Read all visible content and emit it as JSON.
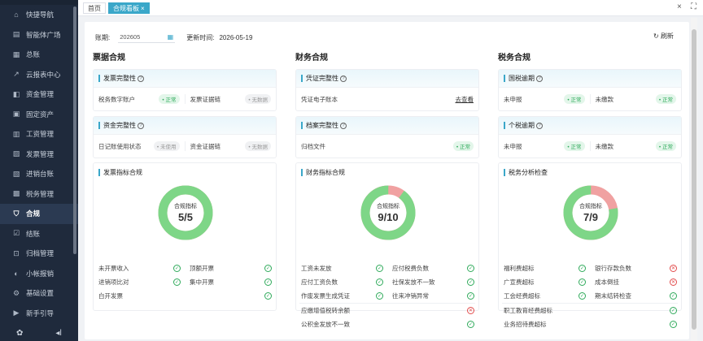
{
  "sidebar": {
    "items": [
      {
        "label": "快捷导航",
        "icon": "home-icon"
      },
      {
        "label": "智能体广场",
        "icon": "agent-icon"
      },
      {
        "label": "总账",
        "icon": "ledger-icon"
      },
      {
        "label": "云报表中心",
        "icon": "chart-icon"
      },
      {
        "label": "资金管理",
        "icon": "money-icon"
      },
      {
        "label": "固定资产",
        "icon": "asset-icon"
      },
      {
        "label": "工资管理",
        "icon": "salary-icon"
      },
      {
        "label": "发票管理",
        "icon": "invoice-icon"
      },
      {
        "label": "进销台账",
        "icon": "inventory-icon"
      },
      {
        "label": "税务管理",
        "icon": "tax-icon"
      },
      {
        "label": "合规",
        "icon": "shield-icon",
        "active": true
      },
      {
        "label": "结账",
        "icon": "close-book-icon"
      },
      {
        "label": "归档管理",
        "icon": "archive-icon"
      },
      {
        "label": "小帐报销",
        "icon": "reimburse-icon"
      },
      {
        "label": "基础设置",
        "icon": "settings-icon"
      },
      {
        "label": "新手引导",
        "icon": "guide-icon"
      }
    ]
  },
  "tabs": [
    {
      "label": "首页"
    },
    {
      "label": "合规看板",
      "active": true
    }
  ],
  "filter": {
    "period_label": "账期:",
    "period_value": "202605",
    "update_label": "更新时间:",
    "update_value": "2026-05-19",
    "refresh_label": "刷新"
  },
  "columns": {
    "c1": {
      "title": "票据合规",
      "card1": {
        "title": "发票完整性",
        "left_label": "税务数字账户",
        "left_badge": "• 正常",
        "right_label": "发票证据链",
        "right_badge": "• 无数据"
      },
      "card2": {
        "title": "资金完整性",
        "left_label": "日记账使用状态",
        "left_badge": "• 未使用",
        "right_label": "资金证据链",
        "right_badge": "• 无数据"
      },
      "donut": {
        "title": "发票指标合规",
        "center_label": "合规指标",
        "value": "5/5",
        "ok": 5,
        "total": 5
      },
      "indicators": [
        {
          "label": "未开票收入",
          "ok": true
        },
        {
          "label": "顶额开票",
          "ok": true
        },
        {
          "label": "进销项比对",
          "ok": true
        },
        {
          "label": "集中开票",
          "ok": true
        },
        {
          "label": "白开发票",
          "ok": true
        }
      ]
    },
    "c2": {
      "title": "财务合规",
      "card1": {
        "title": "凭证完整性",
        "label": "凭证电子账本",
        "link": "去查看"
      },
      "card2": {
        "title": "档案完整性",
        "label": "归档文件",
        "badge": "• 正常"
      },
      "donut": {
        "title": "财务指标合规",
        "center_label": "合规指标",
        "value": "9/10",
        "ok": 9,
        "total": 10
      },
      "indicators": [
        {
          "label": "工资未发放",
          "ok": true
        },
        {
          "label": "应付税费负数",
          "ok": true
        },
        {
          "label": "应付工资负数",
          "ok": true
        },
        {
          "label": "社保发放不一致",
          "ok": true
        },
        {
          "label": "作废发票生成凭证",
          "ok": true
        },
        {
          "label": "往来冲销异常",
          "ok": true
        },
        {
          "label": "应缴增值税转余额",
          "ok": false,
          "full": true
        },
        {
          "label": "公积金发放不一致",
          "ok": true,
          "full": true
        }
      ]
    },
    "c3": {
      "title": "税务合规",
      "card1": {
        "title": "国税逾期",
        "left_label": "未申报",
        "left_badge": "• 正常",
        "right_label": "未缴款",
        "right_badge": "• 正常"
      },
      "card2": {
        "title": "个税逾期",
        "left_label": "未申报",
        "left_badge": "• 正常",
        "right_label": "未缴款",
        "right_badge": "• 正常"
      },
      "donut": {
        "title": "税务分析检查",
        "center_label": "合规指标",
        "value": "7/9",
        "ok": 7,
        "total": 9
      },
      "indicators": [
        {
          "label": "福利费超标",
          "ok": true
        },
        {
          "label": "银行存款负数",
          "ok": false
        },
        {
          "label": "广宣费超标",
          "ok": true
        },
        {
          "label": "成本倒挂",
          "ok": false
        },
        {
          "label": "工会经费超标",
          "ok": true
        },
        {
          "label": "期末结转检查",
          "ok": true
        },
        {
          "label": "职工教育经费超标",
          "ok": true,
          "full": true
        },
        {
          "label": "业务招待费超标",
          "ok": true,
          "full": true
        }
      ]
    }
  },
  "colors": {
    "accent": "#3aa7c9",
    "ok": "#7ed687",
    "bad": "#f0a1a1"
  }
}
